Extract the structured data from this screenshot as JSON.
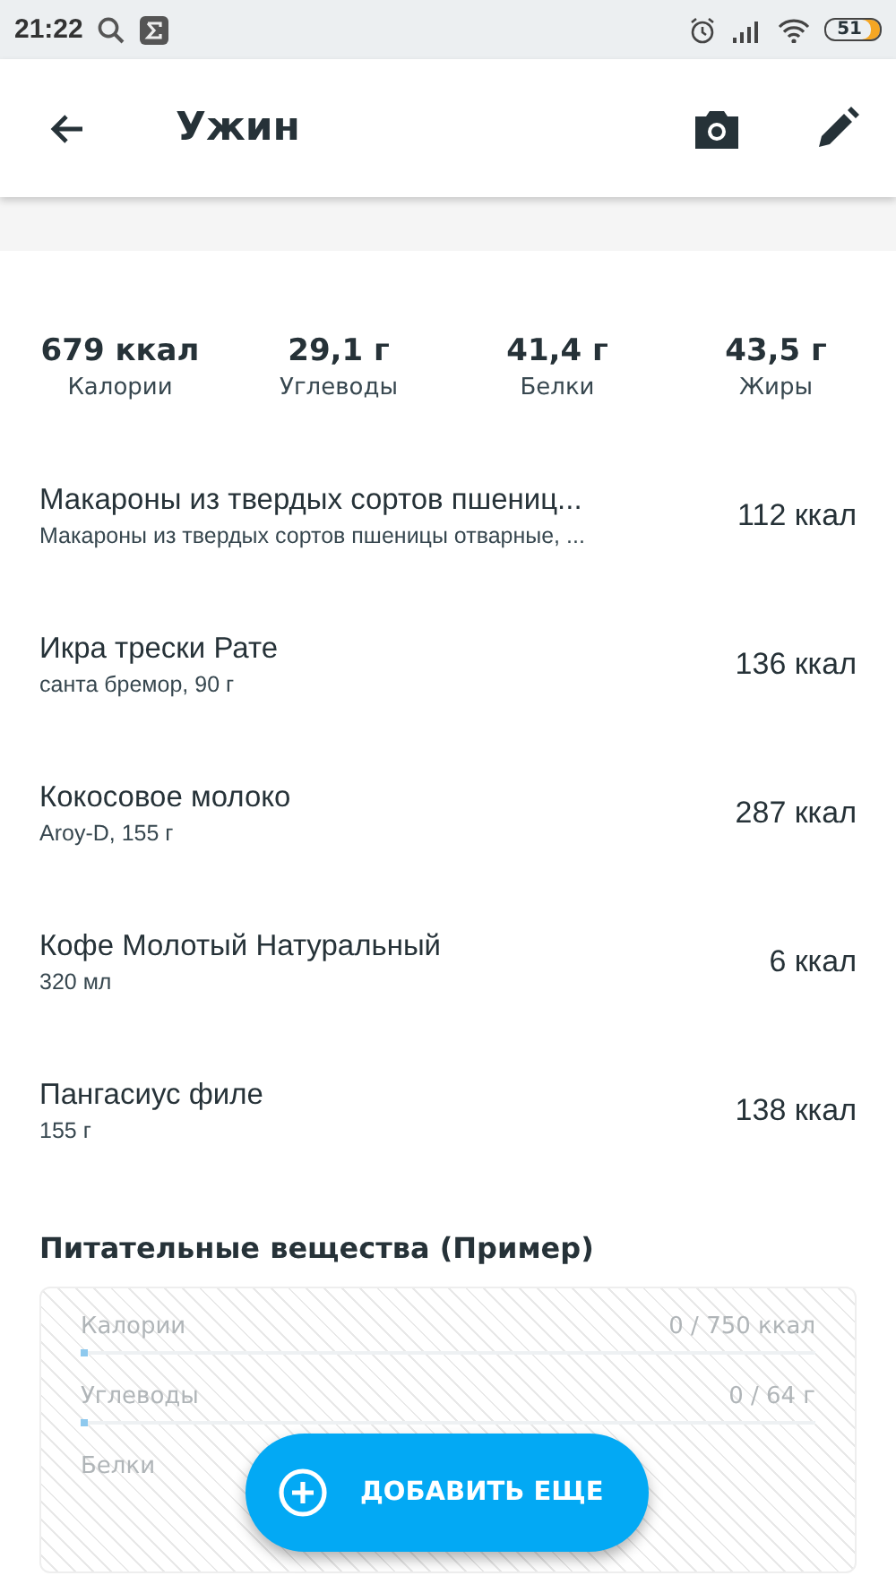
{
  "status_bar": {
    "time": "21:22",
    "battery": "51"
  },
  "app_bar": {
    "title": "Ужин"
  },
  "summary": [
    {
      "value": "679 ккал",
      "label": "Калории"
    },
    {
      "value": "29,1 г",
      "label": "Углеводы"
    },
    {
      "value": "41,4 г",
      "label": "Белки"
    },
    {
      "value": "43,5 г",
      "label": "Жиры"
    }
  ],
  "foods": [
    {
      "name": "Макароны из твердых сортов пшениц...",
      "detail": "Макароны из твердых сортов пшеницы отварные, ...",
      "calories": "112 ккал"
    },
    {
      "name": "Икра трески Рате",
      "detail": "санта бремор, 90 г",
      "calories": "136 ккал"
    },
    {
      "name": "Кокосовое молоко",
      "detail": "Aroy-D, 155 г",
      "calories": "287 ккал"
    },
    {
      "name": "Кофе Молотый Натуральный",
      "detail": "320 мл",
      "calories": "6 ккал"
    },
    {
      "name": "Пангасиус филе",
      "detail": "155 г",
      "calories": "138 ккал"
    }
  ],
  "nutrients": {
    "title": "Питательные вещества (Пример)",
    "rows": [
      {
        "label": "Калории",
        "reading": "0 / 750 ккал",
        "level": 0
      },
      {
        "label": "Углеводы",
        "reading": "0 / 64 г",
        "level": 0
      },
      {
        "label": "Белки"
      }
    ]
  },
  "fab": {
    "label": "ДОБАВИТЬ ЕЩЕ"
  }
}
